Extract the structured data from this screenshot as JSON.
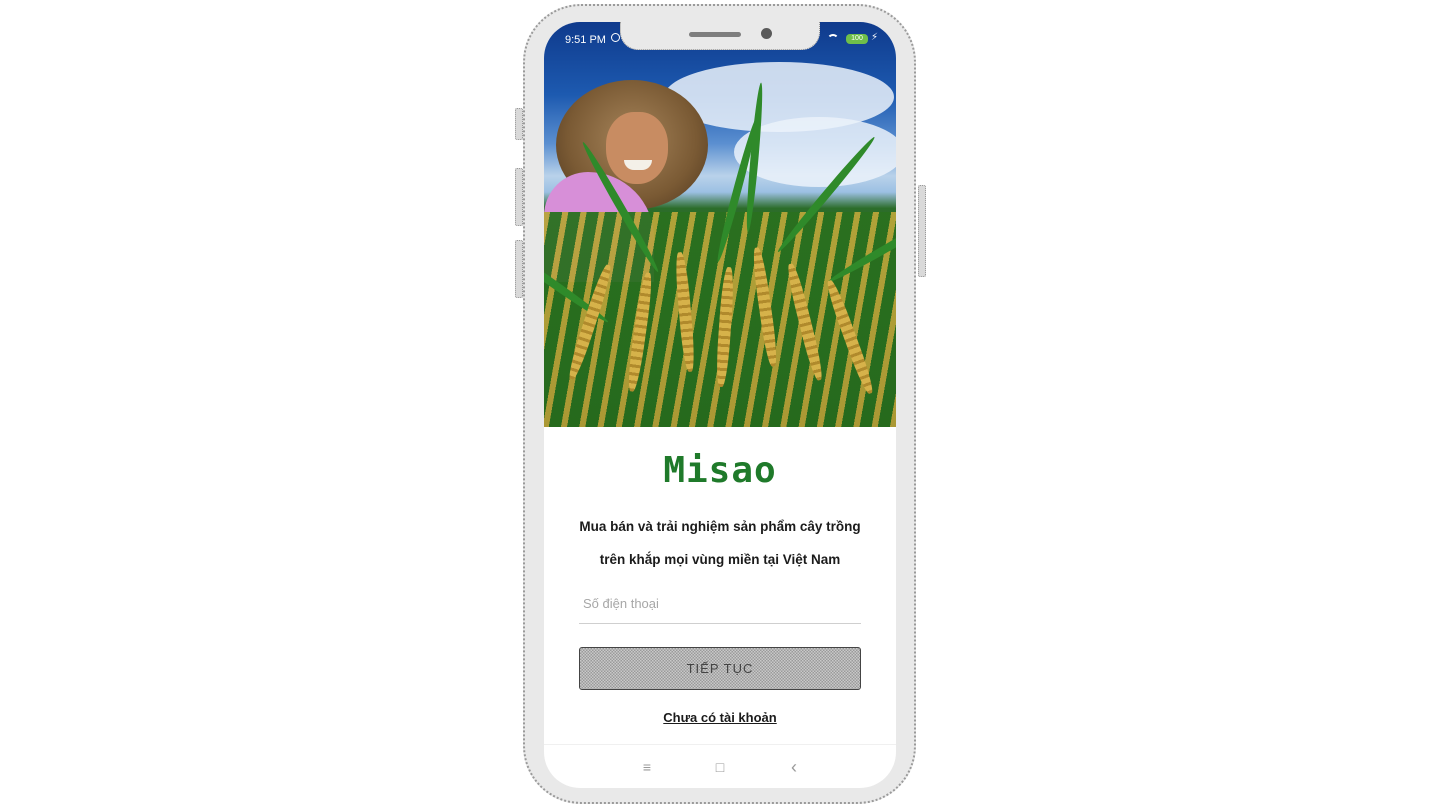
{
  "status_bar": {
    "time": "9:51 PM",
    "battery": "100"
  },
  "brand": {
    "name": "Misao"
  },
  "tagline": {
    "line1": "Mua bán và trải nghiệm sản phẩm cây trồng",
    "line2": "trên khắp mọi vùng miền tại Việt Nam"
  },
  "phone_field": {
    "placeholder": "Số điện thoại",
    "value": ""
  },
  "continue_button": {
    "label": "TIẾP TỤC"
  },
  "register_link": {
    "label": "Chưa có tài khoản"
  },
  "navigation": {
    "menu_icon": "≡",
    "home_icon": "□",
    "back_icon": "‹"
  },
  "colors": {
    "brand_green": "#1f7a2a",
    "battery_green": "#6fbf4a"
  },
  "icons": [
    "alarm-icon",
    "wifi-icon",
    "battery-icon",
    "charging-icon",
    "menu-icon",
    "home-icon",
    "back-icon"
  ]
}
